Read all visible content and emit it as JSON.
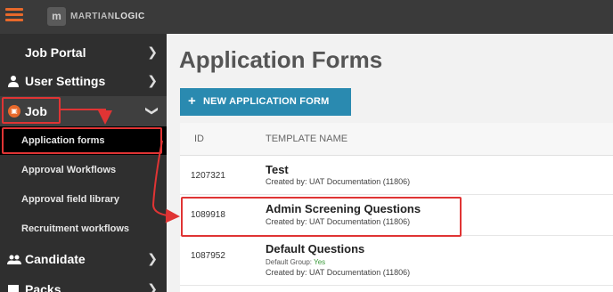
{
  "brand": {
    "icon_text": "m",
    "name_prefix": "MARTIAN",
    "name_suffix": "LOGIC"
  },
  "sidebar": {
    "job_portal": "Job Portal",
    "user_settings": "User Settings",
    "job": "Job",
    "sub_items": [
      "Application forms",
      "Approval Workflows",
      "Approval field library",
      "Recruitment workflows"
    ],
    "candidate": "Candidate",
    "packs": "Packs"
  },
  "main": {
    "title": "Application Forms",
    "new_button": "NEW APPLICATION FORM",
    "columns": {
      "id": "ID",
      "name": "TEMPLATE NAME"
    },
    "rows": [
      {
        "id": "1207321",
        "name": "Test",
        "created": "Created by: UAT Documentation (11806)"
      },
      {
        "id": "1089918",
        "name": "Admin Screening Questions",
        "created": "Created by: UAT Documentation (11806)"
      },
      {
        "id": "1087952",
        "name": "Default Questions",
        "group_label": "Default Group:",
        "group_value": "Yes",
        "created": "Created by: UAT Documentation (11806)"
      }
    ]
  },
  "colors": {
    "accent": "#2a8ab0",
    "sidebar": "#2f2f2f",
    "highlight": "#e03434",
    "brand_orange": "#e8692b"
  }
}
